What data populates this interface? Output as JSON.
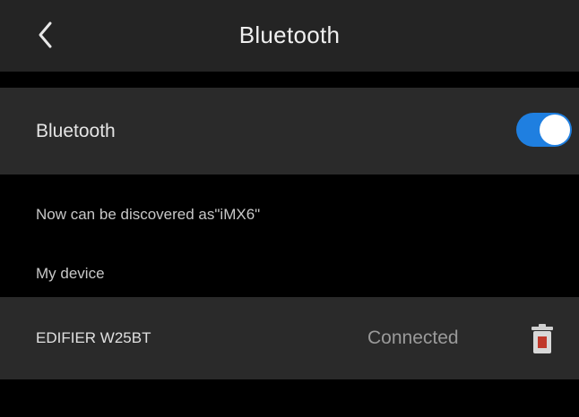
{
  "header": {
    "title": "Bluetooth",
    "back_icon": "chevron-left-icon"
  },
  "bluetooth_toggle": {
    "label": "Bluetooth",
    "enabled": true,
    "accent_color": "#1f7fe0"
  },
  "discoverable_text": "Now can be discovered as\"iMX6\"",
  "my_devices": {
    "title": "My device",
    "items": [
      {
        "name": "EDIFIER W25BT",
        "status": "Connected",
        "action_icon": "trash-icon",
        "action_color": "#c0392b"
      }
    ]
  },
  "colors": {
    "background": "#000000",
    "header_bg": "#242424",
    "row_bg": "#2a2a2a"
  }
}
